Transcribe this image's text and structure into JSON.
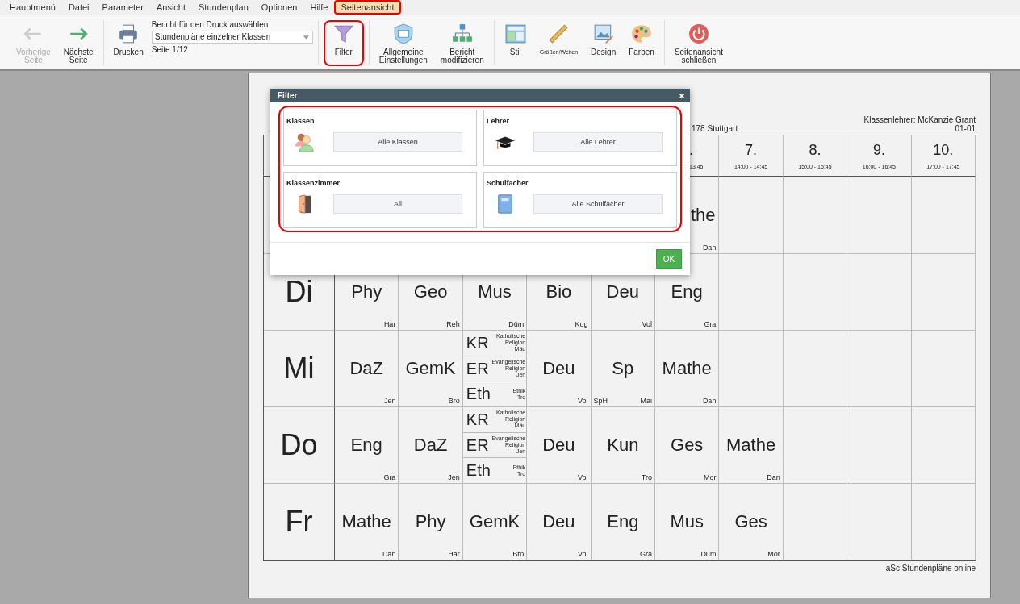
{
  "menu": [
    {
      "label": "Hauptmenü",
      "selected": false,
      "highlighted": false
    },
    {
      "label": "Datei",
      "selected": false,
      "highlighted": false
    },
    {
      "label": "Parameter",
      "selected": false,
      "highlighted": false
    },
    {
      "label": "Ansicht",
      "selected": false,
      "highlighted": false
    },
    {
      "label": "Stundenplan",
      "selected": false,
      "highlighted": false
    },
    {
      "label": "Optionen",
      "selected": false,
      "highlighted": false
    },
    {
      "label": "Hilfe",
      "selected": false,
      "highlighted": false
    },
    {
      "label": "Seitenansicht",
      "selected": true,
      "highlighted": true
    }
  ],
  "toolbar": {
    "groups": [
      {
        "buttons": [
          {
            "lines": [
              "Vorherige",
              "Seite"
            ],
            "disabled": true,
            "highlighted": false
          },
          {
            "lines": [
              "Nächste",
              "Seite"
            ],
            "disabled": false,
            "highlighted": false
          }
        ]
      },
      {
        "buttons": [
          {
            "lines": [
              "Drucken"
            ],
            "disabled": false,
            "highlighted": false
          }
        ],
        "report": {
          "label": "Bericht für den Druck auswählen",
          "value": "Stundenpläne einzelner Klassen",
          "page": "Seite 1/12"
        }
      },
      {
        "buttons": [
          {
            "lines": [
              "Filter"
            ],
            "disabled": false,
            "highlighted": true
          }
        ]
      },
      {
        "buttons": [
          {
            "lines": [
              "Allgemeine",
              "Einstellungen"
            ],
            "disabled": false,
            "highlighted": false
          },
          {
            "lines": [
              "Bericht",
              "modifizieren"
            ],
            "disabled": false,
            "highlighted": false
          }
        ]
      },
      {
        "buttons": [
          {
            "lines": [
              "Stil"
            ],
            "disabled": false,
            "highlighted": false
          },
          {
            "lines": [
              "Größen/Weiten"
            ],
            "disabled": false,
            "highlighted": false
          },
          {
            "lines": [
              "Design"
            ],
            "disabled": false,
            "highlighted": false
          },
          {
            "lines": [
              "Farben"
            ],
            "disabled": false,
            "highlighted": false
          }
        ]
      },
      {
        "buttons": [
          {
            "lines": [
              "Seitenansicht",
              "schließen"
            ],
            "disabled": false,
            "highlighted": false
          }
        ]
      }
    ]
  },
  "schedule": {
    "header_left": "178 Stuttgart",
    "teacher": "Klassenlehrer: McKanzie Grant",
    "class": "01-01",
    "footer": "aSc Stundenpläne online",
    "periods": [
      {
        "kind": "cut",
        "number": ".",
        "time": "13:45"
      },
      {
        "kind": "full",
        "number": "7.",
        "time": "14:00 - 14:45"
      },
      {
        "kind": "full",
        "number": "8.",
        "time": "15:00 - 15:45"
      },
      {
        "kind": "full",
        "number": "9.",
        "time": "16:00 - 16:45"
      },
      {
        "kind": "full",
        "number": "10.",
        "time": "17:00 - 17:45"
      }
    ],
    "days": [
      {
        "cells": [
          {
            "kind": "empty"
          },
          {
            "kind": "empty"
          },
          {
            "kind": "empty"
          },
          {
            "kind": "empty"
          },
          {
            "kind": "empty"
          },
          {
            "kind": "cut",
            "subject": "the",
            "teacher": "Dan"
          }
        ]
      },
      {
        "label": "Di",
        "cells": [
          {
            "kind": "lesson",
            "subject": "Phy",
            "teacher": "Har"
          },
          {
            "kind": "lesson",
            "subject": "Geo",
            "teacher": "Reh"
          },
          {
            "kind": "lesson",
            "subject": "Mus",
            "teacher": "Düm"
          },
          {
            "kind": "lesson",
            "subject": "Bio",
            "teacher": "Kug"
          },
          {
            "kind": "lesson",
            "subject": "Deu",
            "teacher": "Vol"
          },
          {
            "kind": "lesson",
            "subject": "Eng",
            "teacher": "Gra"
          }
        ]
      },
      {
        "label": "Mi",
        "cells": [
          {
            "kind": "lesson",
            "subject": "DaZ",
            "teacher": "Jen"
          },
          {
            "kind": "lesson",
            "subject": "GemK",
            "teacher": "Bro"
          },
          {
            "kind": "split",
            "parts": [
              {
                "subject": "KR",
                "name": "Katholische Religion",
                "teacher": "Mäu"
              },
              {
                "subject": "ER",
                "name": "Evangelische Religion",
                "teacher": "Jen"
              },
              {
                "subject": "Eth",
                "name": "Ethik",
                "teacher": "Tro"
              }
            ]
          },
          {
            "kind": "lesson",
            "subject": "Deu",
            "teacher": "Vol"
          },
          {
            "kind": "lesson",
            "subject": "Sp",
            "room": "SpH",
            "teacher": "Mai"
          },
          {
            "kind": "lesson",
            "subject": "Mathe",
            "teacher": "Dan"
          }
        ]
      },
      {
        "label": "Do",
        "cells": [
          {
            "kind": "lesson",
            "subject": "Eng",
            "teacher": "Gra"
          },
          {
            "kind": "lesson",
            "subject": "DaZ",
            "teacher": "Jen"
          },
          {
            "kind": "split",
            "parts": [
              {
                "subject": "KR",
                "name": "Katholische Religion",
                "teacher": "Mäu"
              },
              {
                "subject": "ER",
                "name": "Evangelische Religion",
                "teacher": "Jen"
              },
              {
                "subject": "Eth",
                "name": "Ethik",
                "teacher": "Tro"
              }
            ]
          },
          {
            "kind": "lesson",
            "subject": "Deu",
            "teacher": "Vol"
          },
          {
            "kind": "lesson",
            "subject": "Kun",
            "teacher": "Tro"
          },
          {
            "kind": "lesson",
            "subject": "Ges",
            "teacher": "Mor"
          },
          {
            "kind": "lesson",
            "subject": "Mathe",
            "teacher": "Dan"
          }
        ]
      },
      {
        "label": "Fr",
        "cells": [
          {
            "kind": "lesson",
            "subject": "Mathe",
            "teacher": "Dan"
          },
          {
            "kind": "lesson",
            "subject": "Phy",
            "teacher": "Har"
          },
          {
            "kind": "lesson",
            "subject": "GemK",
            "teacher": "Bro"
          },
          {
            "kind": "lesson",
            "subject": "Deu",
            "teacher": "Vol"
          },
          {
            "kind": "lesson",
            "subject": "Eng",
            "teacher": "Gra"
          },
          {
            "kind": "lesson",
            "subject": "Mus",
            "teacher": "Düm"
          },
          {
            "kind": "lesson",
            "subject": "Ges",
            "teacher": "Mor"
          }
        ]
      }
    ]
  },
  "dialog": {
    "title": "Filter",
    "highlighted": true,
    "sections": [
      {
        "title": "Klassen",
        "value": "Alle Klassen"
      },
      {
        "title": "Lehrer",
        "value": "Alle Lehrer"
      },
      {
        "title": "Klassenzimmer",
        "value": "All"
      },
      {
        "title": "Schulfächer",
        "value": "Alle Schulfächer"
      }
    ],
    "ok": "OK"
  }
}
